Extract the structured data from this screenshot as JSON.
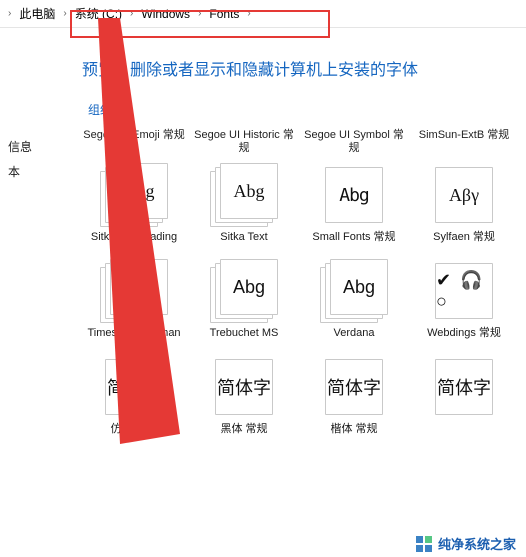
{
  "breadcrumb": {
    "root_chev": "›",
    "this_pc": "此电脑",
    "sys_drive": "系统 (C:)",
    "windows": "Windows",
    "fonts": "Fonts",
    "chev": "›"
  },
  "sidebar": {
    "info": "信息",
    "text": "本"
  },
  "heading": "预览、删除或者显示和隐藏计算机上安装的字体",
  "toolbar": {
    "organize": "组织",
    "dd": "▼"
  },
  "top_labels": {
    "c0": "Segoe UI Emoji 常规",
    "c1": "Segoe UI Historic 常规",
    "c2": "Segoe UI Symbol 常规",
    "c3": "SimSun-ExtB 常规"
  },
  "row1": {
    "t0": {
      "sample": "Abg",
      "label": "Sitka Subheading"
    },
    "t1": {
      "sample": "Abg",
      "label": "Sitka Text"
    },
    "t2": {
      "sample": "Abg",
      "label": "Small Fonts 常规"
    },
    "t3": {
      "sample": "Aβγ",
      "label": "Sylfaen 常规"
    }
  },
  "row2": {
    "t0": {
      "sample": "Abg",
      "label": "Times New Roman"
    },
    "t1": {
      "sample": "Abg",
      "label": "Trebuchet MS"
    },
    "t2": {
      "sample": "Abg",
      "label": "Verdana"
    },
    "t3": {
      "sample": "✔ 🎧 ○",
      "label": "Webdings 常规"
    }
  },
  "row3": {
    "t0": {
      "sample": "简体字",
      "label": "仿宋 常规"
    },
    "t1": {
      "sample": "简体字",
      "label": "黑体 常规"
    },
    "t2": {
      "sample": "简体字",
      "label": "楷体 常规"
    },
    "t3": {
      "sample": "简体字",
      "label": ""
    }
  },
  "watermark": {
    "text": "纯净系统之家"
  }
}
